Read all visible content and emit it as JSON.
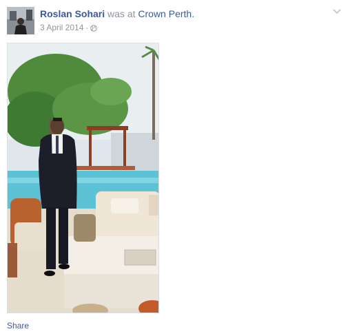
{
  "post": {
    "author": "Roslan Sohari",
    "action": "was at",
    "place": "Crown Perth.",
    "date": "3 April 2014",
    "separator": "·",
    "audience_icon": "globe-icon",
    "menu_icon": "chevron-down-icon"
  },
  "actions": {
    "share_label": "Share"
  },
  "colors": {
    "link": "#3b5998",
    "meta": "#90949c",
    "background": "#ffffff"
  }
}
